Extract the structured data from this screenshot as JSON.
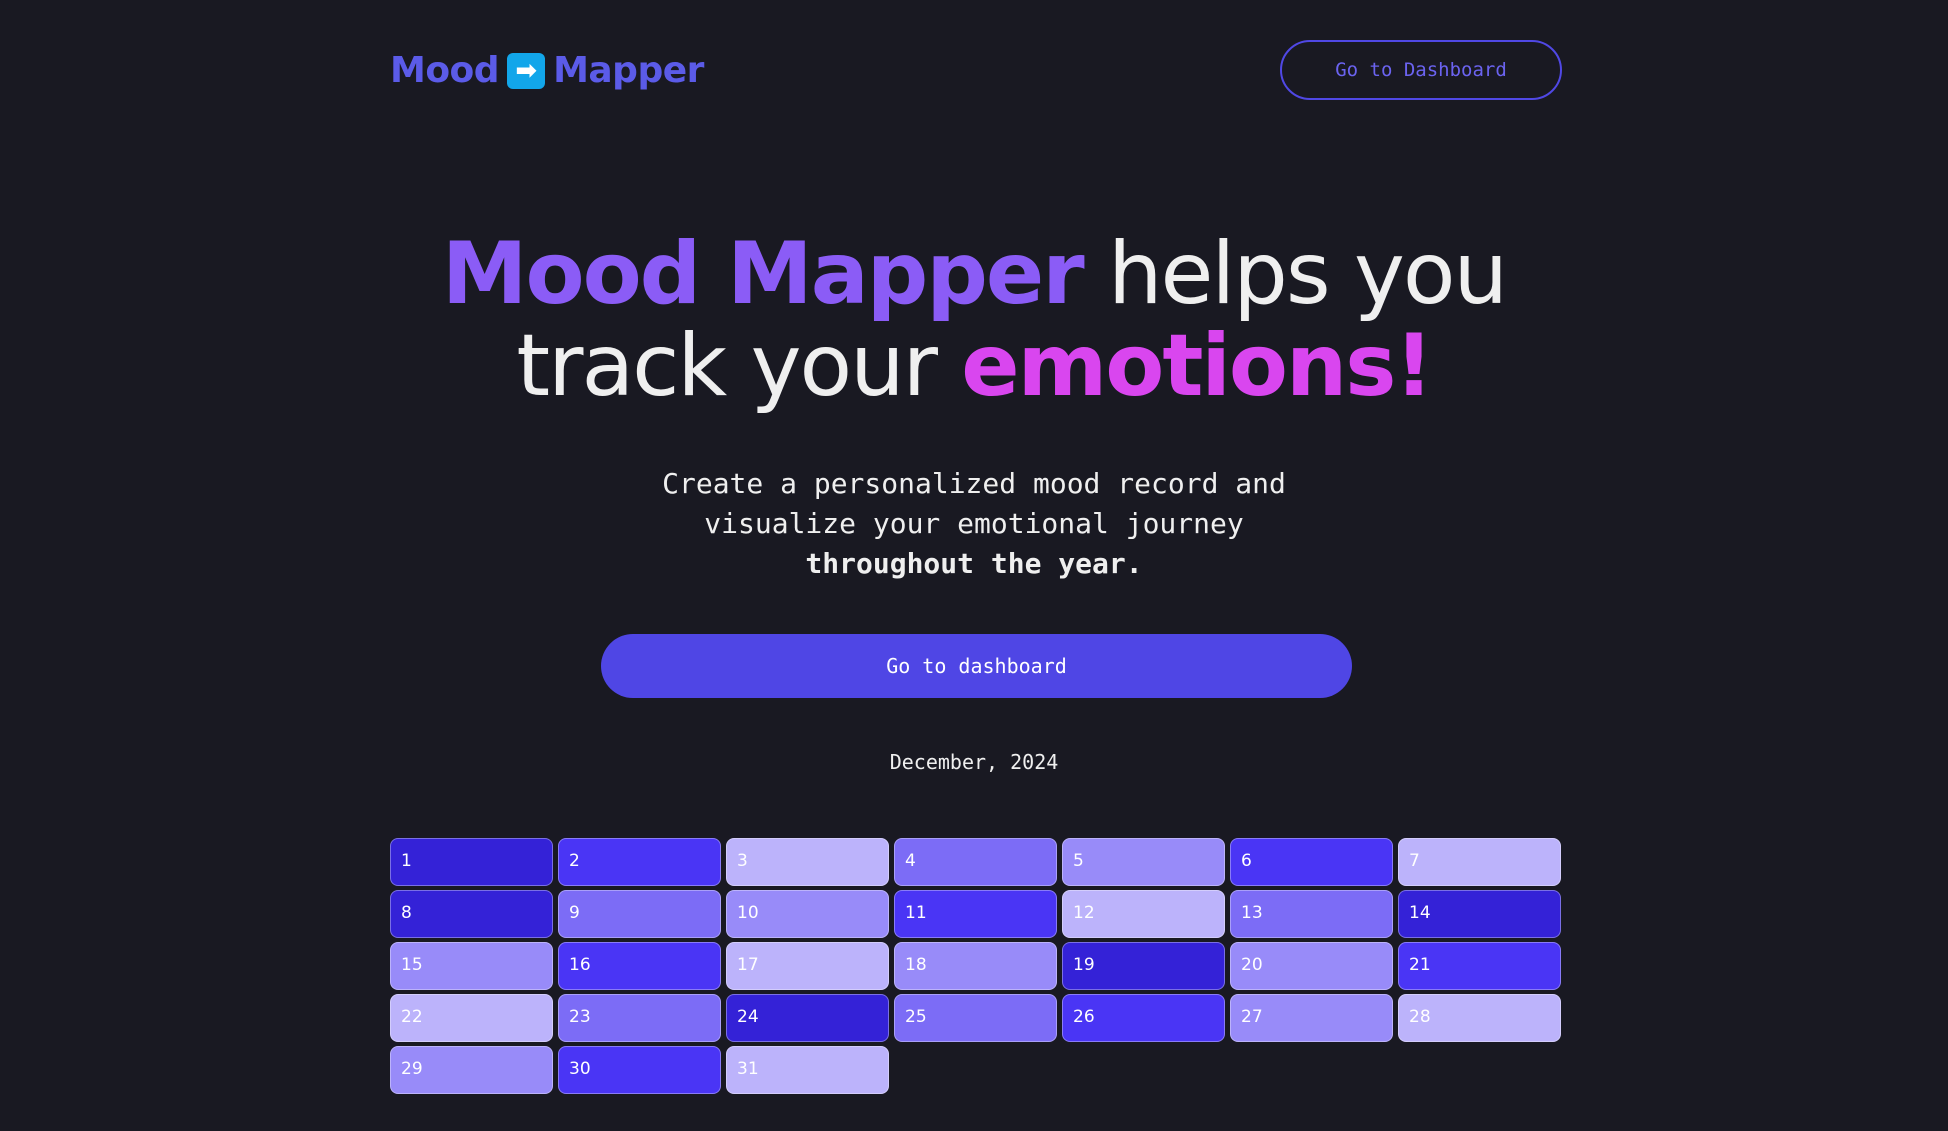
{
  "header": {
    "logo_left": "Mood",
    "logo_arrow": "➡",
    "logo_right": "Mapper",
    "dashboard_button": "Go to Dashboard"
  },
  "hero": {
    "part1": "Mood Mapper",
    "part2": " helps you",
    "part3": "track your ",
    "part4": "emotions!"
  },
  "subtitle": {
    "line1": "Create a personalized mood record and",
    "line2": "visualize your emotional journey",
    "line3": "throughout the year."
  },
  "cta_label": "Go to dashboard",
  "calendar": {
    "month_label": "December, 2024",
    "days": [
      {
        "day": "1",
        "mood": 1
      },
      {
        "day": "2",
        "mood": 2
      },
      {
        "day": "3",
        "mood": 5
      },
      {
        "day": "4",
        "mood": 3
      },
      {
        "day": "5",
        "mood": 4
      },
      {
        "day": "6",
        "mood": 2
      },
      {
        "day": "7",
        "mood": 5
      },
      {
        "day": "8",
        "mood": 1
      },
      {
        "day": "9",
        "mood": 3
      },
      {
        "day": "10",
        "mood": 4
      },
      {
        "day": "11",
        "mood": 2
      },
      {
        "day": "12",
        "mood": 5
      },
      {
        "day": "13",
        "mood": 3
      },
      {
        "day": "14",
        "mood": 1
      },
      {
        "day": "15",
        "mood": 4
      },
      {
        "day": "16",
        "mood": 2
      },
      {
        "day": "17",
        "mood": 5
      },
      {
        "day": "18",
        "mood": 4
      },
      {
        "day": "19",
        "mood": 1
      },
      {
        "day": "20",
        "mood": 4
      },
      {
        "day": "21",
        "mood": 2
      },
      {
        "day": "22",
        "mood": 5
      },
      {
        "day": "23",
        "mood": 3
      },
      {
        "day": "24",
        "mood": 1
      },
      {
        "day": "25",
        "mood": 3
      },
      {
        "day": "26",
        "mood": 2
      },
      {
        "day": "27",
        "mood": 4
      },
      {
        "day": "28",
        "mood": 5
      },
      {
        "day": "29",
        "mood": 4
      },
      {
        "day": "30",
        "mood": 2
      },
      {
        "day": "31",
        "mood": 5
      }
    ]
  },
  "colors": {
    "background": "#191922",
    "brand": "#5b5be8",
    "accent_purple": "#8b5cf6",
    "accent_magenta": "#d946ef",
    "cta": "#4f46e5",
    "mood_levels": [
      "#3422d7",
      "#4a35f5",
      "#7c6cf6",
      "#988bf9",
      "#bcb3fb"
    ]
  }
}
